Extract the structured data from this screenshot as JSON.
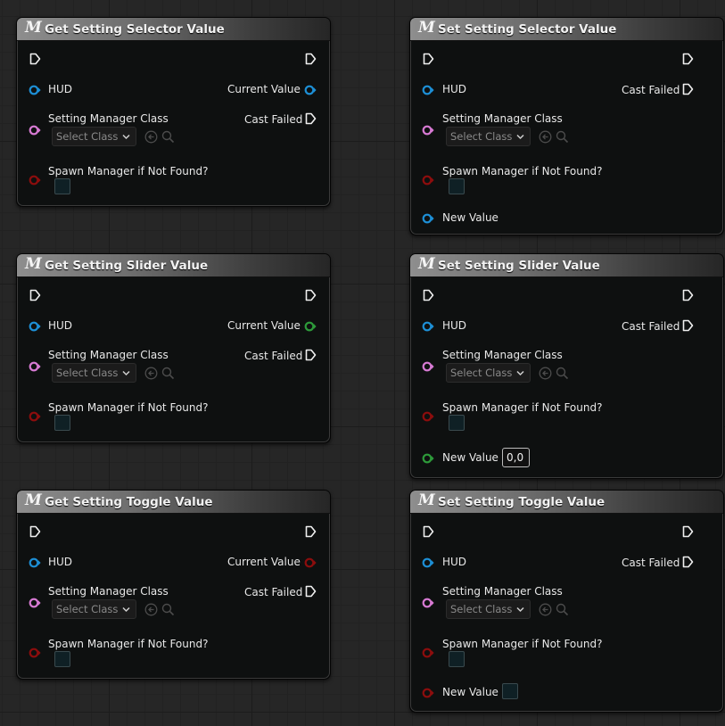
{
  "labels": {
    "hud": "HUD",
    "setting_manager_class": "Setting Manager Class",
    "select_class": "Select Class",
    "spawn_manager": "Spawn Manager if Not Found?",
    "current_value": "Current Value",
    "cast_failed": "Cast Failed",
    "new_value": "New Value",
    "m_glyph": "M"
  },
  "colors": {
    "pin_object": "#1d8fd6",
    "pin_class": "#d77ad3",
    "pin_bool": "#8c0d0d",
    "pin_struct": "#2d9a3a",
    "exec": "#efefef"
  },
  "nodes": [
    {
      "id": "get-setting-selector-value",
      "title": "Get Setting Selector Value",
      "output_pin": "object"
    },
    {
      "id": "set-setting-selector-value",
      "title": "Set Setting Selector Value",
      "new_value_pin": "object"
    },
    {
      "id": "get-setting-slider-value",
      "title": "Get Setting Slider Value",
      "output_pin": "struct"
    },
    {
      "id": "set-setting-slider-value",
      "title": "Set Setting Slider Value",
      "new_value_pin": "struct",
      "new_value_default": "0,0"
    },
    {
      "id": "get-setting-toggle-value",
      "title": "Get Setting Toggle Value",
      "output_pin": "bool"
    },
    {
      "id": "set-setting-toggle-value",
      "title": "Set Setting Toggle Value",
      "new_value_pin": "bool"
    }
  ]
}
